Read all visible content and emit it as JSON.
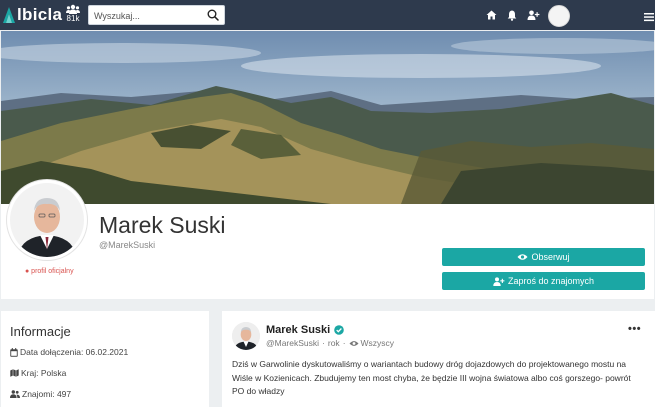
{
  "app": {
    "logo_text": "lbicla",
    "members_count": "81k",
    "search_placeholder": "Wyszukaj..."
  },
  "nav": {
    "icons": [
      "home-icon",
      "bell-icon",
      "add-user-icon",
      "menu-icon"
    ]
  },
  "profile": {
    "name": "Marek Suski",
    "handle": "@MarekSuski",
    "official_label": "● profil oficjalny",
    "follow_label": "Obserwuj",
    "invite_label": "Zaproś do znajomych"
  },
  "info": {
    "title": "Informacje",
    "joined": "Data dołączenia: 06.02.2021",
    "country": "Kraj: Polska",
    "friends": "Znajomi: 497"
  },
  "post": {
    "author": "Marek Suski",
    "handle": "@MarekSuski",
    "time": "rok",
    "visibility": "Wszyscy",
    "menu": "•••",
    "text": "Dziś w Garwolinie dyskutowaliśmy o wariantach budowy dróg dojazdowych do projektowanego mostu na Wiśle w Kozienicach. Zbudujemy ten most chyba, że będzie III wojna światowa albo coś gorszego- powrót PO do władzy"
  },
  "colors": {
    "topbar": "#2e3a4d",
    "accent": "#1ba7a4",
    "official": "#d9534f",
    "verified": "#1ba7a4"
  }
}
